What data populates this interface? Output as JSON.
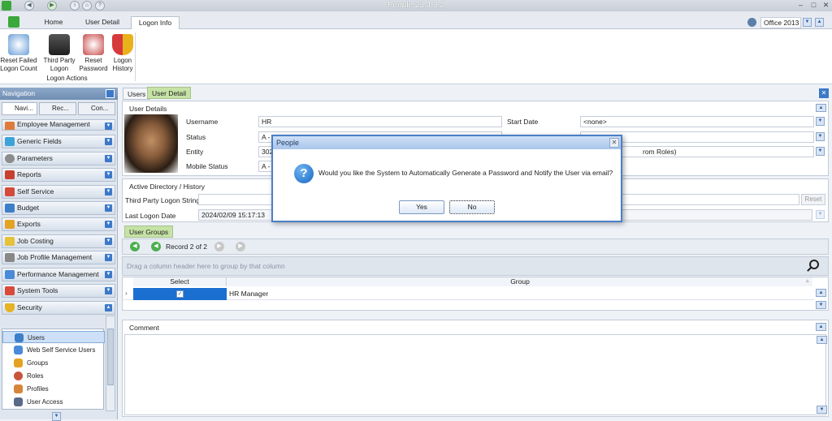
{
  "window": {
    "title": "People 23.4.3.2"
  },
  "ribbon": {
    "tabs": [
      "Home",
      "User Detail",
      "Logon Info"
    ],
    "theme_value": "Office 2013",
    "buttons": [
      {
        "line1": "Reset Failed",
        "line2": "Logon Count"
      },
      {
        "line1": "Third Party",
        "line2": "Logon"
      },
      {
        "line1": "Reset",
        "line2": "Password"
      },
      {
        "line1": "Logon",
        "line2": "History"
      }
    ],
    "group_label": "Logon Actions"
  },
  "nav": {
    "header": "Navigation",
    "tabs": [
      "Navi...",
      "Rec...",
      "Con..."
    ],
    "items": [
      "Employee Management",
      "Generic Fields",
      "Parameters",
      "Reports",
      "Self Service",
      "Budget",
      "Exports",
      "Job Costing",
      "Job Profile Management",
      "Performance Management",
      "System Tools",
      "Security"
    ],
    "tree": [
      "Users",
      "Web Self Service Users",
      "Groups",
      "Roles",
      "Profiles",
      "User Access"
    ]
  },
  "main": {
    "subtabs": [
      "Users",
      "User Detail"
    ],
    "user_details": {
      "title": "User Details",
      "labels": {
        "username": "Username",
        "status": "Status",
        "entity": "Entity",
        "mobile_status": "Mobile Status",
        "start_date": "Start Date"
      },
      "values": {
        "username": "HR",
        "status": "A - ",
        "entity": "302",
        "mobile_status": "A - ",
        "start_date": "<none>",
        "roles_field": "rom Roles)"
      }
    },
    "active_directory": {
      "title": "Active Directory / History",
      "third_party_label": "Third Party Logon String",
      "reset_label": "Reset",
      "last_logon_label": "Last Logon Date",
      "last_logon_value": "2024/02/09 15:17:13"
    },
    "user_groups": {
      "tab": "User Groups",
      "record": "Record 2 of 2",
      "group_hint": "Drag a column header here to group by that column",
      "columns": [
        "Select",
        "Group"
      ],
      "rows": [
        {
          "select": true,
          "group": "HR Manager"
        }
      ]
    },
    "comment": {
      "title": "Comment"
    }
  },
  "dialog": {
    "title": "People",
    "message": "Would you like the System to Automatically Generate a Password and Notify the User via email?",
    "yes": "Yes",
    "no": "No"
  },
  "colors": {
    "accent": "#3b78c8",
    "green_tab": "#c6e3a6",
    "selected_row": "#1a6fd1"
  }
}
